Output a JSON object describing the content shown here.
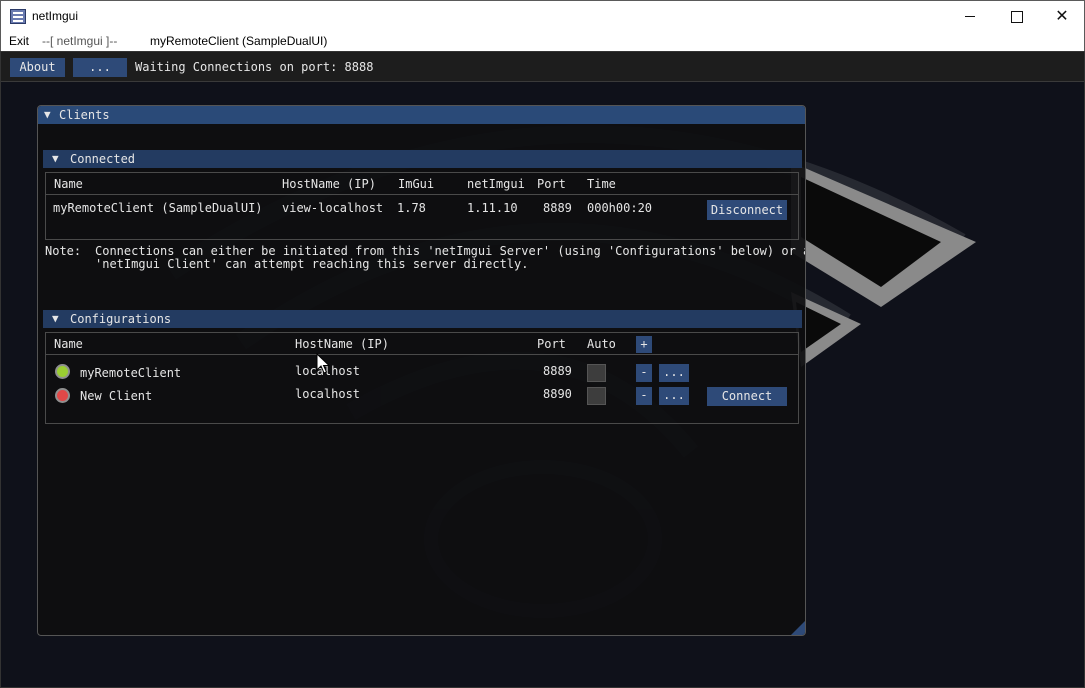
{
  "window": {
    "title": "netImgui",
    "controls": [
      "minimize",
      "maximize",
      "close"
    ]
  },
  "menubar": {
    "exit": "Exit",
    "separator": "--[ netImgui ]--",
    "client": "myRemoteClient (SampleDualUI)"
  },
  "toolbar": {
    "about_label": "About",
    "more_label": "...",
    "status": "Waiting Connections on port: 8888"
  },
  "clients_window": {
    "title": "Clients",
    "connected": {
      "title": "Connected",
      "columns": [
        "Name",
        "HostName (IP)",
        "ImGui",
        "netImgui",
        "Port",
        "Time"
      ],
      "rows": [
        {
          "name": "myRemoteClient (SampleDualUI)",
          "hostname": "view-localhost",
          "imgui": "1.78",
          "netimgui": "1.11.10",
          "port": "8889",
          "time": "000h00:20",
          "action": "Disconnect"
        }
      ]
    },
    "note": {
      "label": "Note:",
      "line1": "Connections can either be initiated from this 'netImgui Server' (using 'Configurations' below) or a",
      "line2": "'netImgui Client' can attempt reaching this server directly."
    },
    "configurations": {
      "title": "Configurations",
      "columns": [
        "Name",
        "HostName (IP)",
        "Port",
        "Auto"
      ],
      "add_label": "+",
      "rows": [
        {
          "name": "myRemoteClient",
          "hostname": "localhost",
          "port": "8889",
          "auto": false,
          "status_color": "#9acd32",
          "remove_label": "-",
          "edit_label": "...",
          "action": ""
        },
        {
          "name": "New Client",
          "hostname": "localhost",
          "port": "8890",
          "auto": false,
          "status_color": "#e04848",
          "remove_label": "-",
          "edit_label": "...",
          "action": "Connect"
        }
      ]
    }
  },
  "colors": {
    "accent": "#2e4a78",
    "title_bar": "#2a4a78",
    "background": "#0f111a"
  }
}
